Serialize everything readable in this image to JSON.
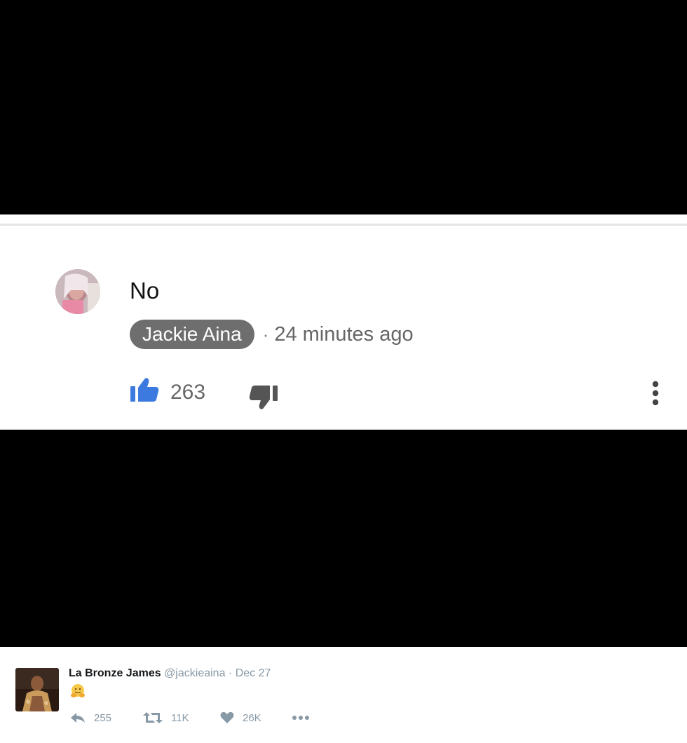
{
  "comment": {
    "text": "No",
    "author": "Jackie Aina",
    "separator": "·",
    "time": "24 minutes ago",
    "likes": "263",
    "colors": {
      "like": "#3d7ae0",
      "dislike": "#555555",
      "author_badge": "#6e6e6e"
    },
    "icons": [
      "avatar",
      "thumbs-up-icon",
      "thumbs-down-icon",
      "more-vert-icon"
    ]
  },
  "tweet": {
    "name": "La Bronze James",
    "handle": "@jackieaina",
    "date": "· Dec 27",
    "emoji": "hugging-face-emoji",
    "reply_count": "255",
    "retweet_count": "11K",
    "like_count": "26K",
    "icons": [
      "reply-icon",
      "retweet-icon",
      "heart-icon",
      "more-dots-icon"
    ]
  }
}
